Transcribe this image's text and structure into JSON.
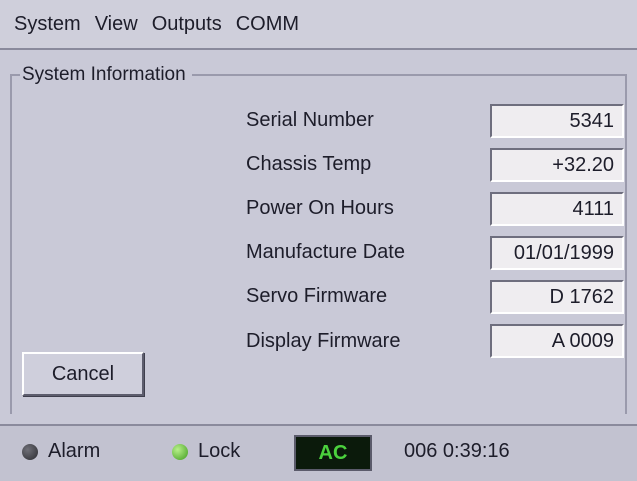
{
  "menu": {
    "items": [
      "System",
      "View",
      "Outputs",
      "COMM"
    ]
  },
  "group": {
    "title": "System Information"
  },
  "rows": [
    {
      "label": "Serial Number",
      "value": "5341"
    },
    {
      "label": "Chassis Temp",
      "value": "+32.20"
    },
    {
      "label": "Power On Hours",
      "value": "4111"
    },
    {
      "label": "Manufacture Date",
      "value": "01/01/1999"
    },
    {
      "label": "Servo Firmware",
      "value": "D 1762"
    },
    {
      "label": "Display Firmware",
      "value": "A 0009"
    }
  ],
  "buttons": {
    "cancel": "Cancel"
  },
  "status": {
    "alarm_label": "Alarm",
    "lock_label": "Lock",
    "mode": "AC",
    "time": "006 0:39:16",
    "alarm_led_color": "#2a2a30",
    "lock_led_color": "#3f9b1e",
    "mode_color": "#4bd13d"
  }
}
